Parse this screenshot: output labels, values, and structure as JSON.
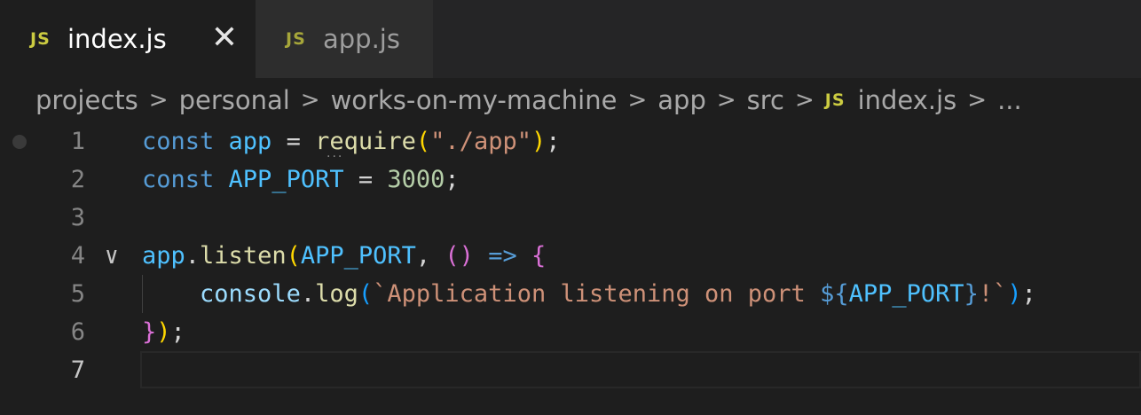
{
  "tabs": [
    {
      "icon": "JS",
      "label": "index.js",
      "active": true,
      "close": "✕"
    },
    {
      "icon": "JS",
      "label": "app.js",
      "active": false
    }
  ],
  "breadcrumb": {
    "items": [
      "projects",
      "personal",
      "works-on-my-machine",
      "app",
      "src"
    ],
    "file_icon": "JS",
    "file": "index.js",
    "more": "...",
    "separator": ">"
  },
  "editor": {
    "line_numbers": [
      "1",
      "2",
      "3",
      "4",
      "5",
      "6",
      "7"
    ],
    "current_line": 7,
    "fold_marker": "∨",
    "hint_dots": "...",
    "lines": [
      [
        {
          "t": "const",
          "c": "kw"
        },
        {
          "t": " ",
          "c": "op"
        },
        {
          "t": "app",
          "c": "var"
        },
        {
          "t": " = ",
          "c": "op"
        },
        {
          "t": "require",
          "c": "fn"
        },
        {
          "t": "(",
          "c": "brace"
        },
        {
          "t": "\"./app\"",
          "c": "str"
        },
        {
          "t": ")",
          "c": "brace"
        },
        {
          "t": ";",
          "c": "op"
        }
      ],
      [
        {
          "t": "const",
          "c": "kw"
        },
        {
          "t": " ",
          "c": "op"
        },
        {
          "t": "APP_PORT",
          "c": "var"
        },
        {
          "t": " = ",
          "c": "op"
        },
        {
          "t": "3000",
          "c": "num"
        },
        {
          "t": ";",
          "c": "op"
        }
      ],
      [],
      [
        {
          "t": "app",
          "c": "var"
        },
        {
          "t": ".",
          "c": "op"
        },
        {
          "t": "listen",
          "c": "fn"
        },
        {
          "t": "(",
          "c": "brace"
        },
        {
          "t": "APP_PORT",
          "c": "var"
        },
        {
          "t": ", ",
          "c": "op"
        },
        {
          "t": "()",
          "c": "paren2"
        },
        {
          "t": " ",
          "c": "op"
        },
        {
          "t": "=>",
          "c": "arrow"
        },
        {
          "t": " ",
          "c": "op"
        },
        {
          "t": "{",
          "c": "paren2"
        }
      ],
      [
        {
          "t": "    ",
          "c": "op"
        },
        {
          "t": "console",
          "c": "prop"
        },
        {
          "t": ".",
          "c": "op"
        },
        {
          "t": "log",
          "c": "fn"
        },
        {
          "t": "(",
          "c": "paren3"
        },
        {
          "t": "`Application listening on port ",
          "c": "str"
        },
        {
          "t": "${",
          "c": "tpl-punct"
        },
        {
          "t": "APP_PORT",
          "c": "var"
        },
        {
          "t": "}",
          "c": "tpl-punct"
        },
        {
          "t": "!`",
          "c": "str"
        },
        {
          "t": ")",
          "c": "paren3"
        },
        {
          "t": ";",
          "c": "op"
        }
      ],
      [
        {
          "t": "}",
          "c": "paren2"
        },
        {
          "t": ")",
          "c": "brace"
        },
        {
          "t": ";",
          "c": "op"
        }
      ],
      []
    ]
  },
  "colors": {
    "background": "#1e1e1e",
    "tabbar": "#252526",
    "js_icon": "#cbcb41",
    "keyword": "#569cd6",
    "variable": "#4fc1ff",
    "function": "#dcdcaa",
    "string": "#ce9178",
    "number": "#b5cea8"
  }
}
